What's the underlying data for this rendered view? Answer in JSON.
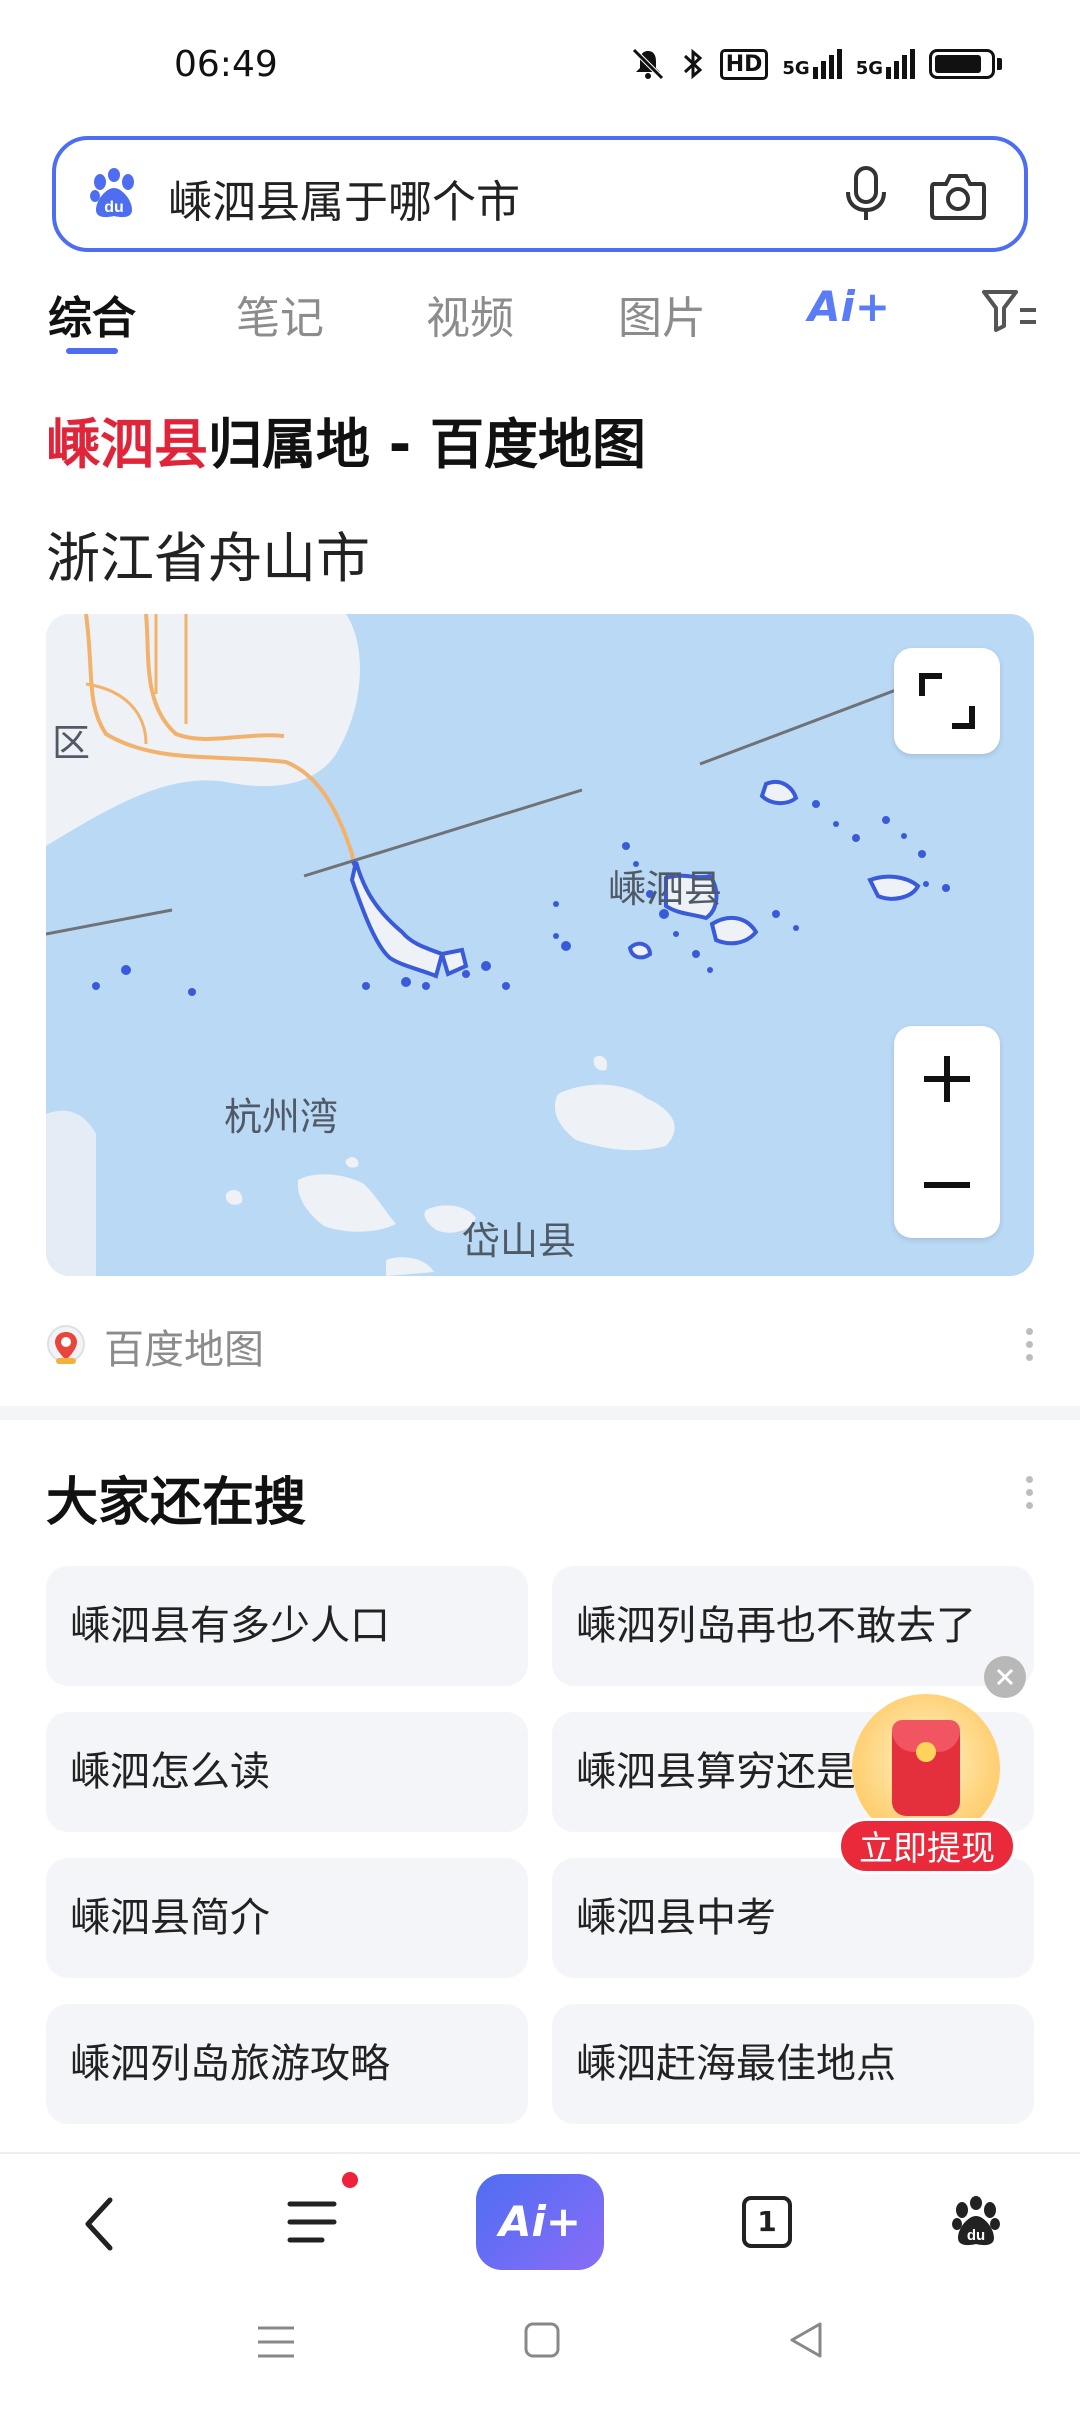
{
  "status_bar": {
    "time": "06:49",
    "icons": [
      "mute-icon",
      "bluetooth-icon",
      "hd-icon",
      "signal-5g-icon",
      "signal-5g-icon",
      "battery-icon"
    ],
    "hd_label": "HD",
    "net1_label": "5G",
    "net2_label": "5G"
  },
  "search": {
    "query": "嵊泗县属于哪个市"
  },
  "tabs": {
    "items": [
      "综合",
      "笔记",
      "视频",
      "图片"
    ],
    "ai_label": "Ai+"
  },
  "result": {
    "title_highlight": "嵊泗县",
    "title_rest": "归属地 - 百度地图",
    "subtitle": "浙江省舟山市",
    "map_labels": {
      "district": "区",
      "county": "嵊泗县",
      "bay": "杭州湾",
      "daishan": "岱山县"
    },
    "source": "百度地图"
  },
  "related": {
    "title": "大家还在搜",
    "items": [
      "嵊泗县有多少人口",
      "嵊泗列岛再也不敢去了",
      "嵊泗怎么读",
      "嵊泗县算穷还是",
      "嵊泗县简介",
      "嵊泗县中考",
      "嵊泗列岛旅游攻略",
      "嵊泗赶海最佳地点"
    ]
  },
  "float": {
    "label": "立即提现"
  },
  "bottom_nav": {
    "ai_label": "Ai+",
    "tab_count": "1"
  }
}
